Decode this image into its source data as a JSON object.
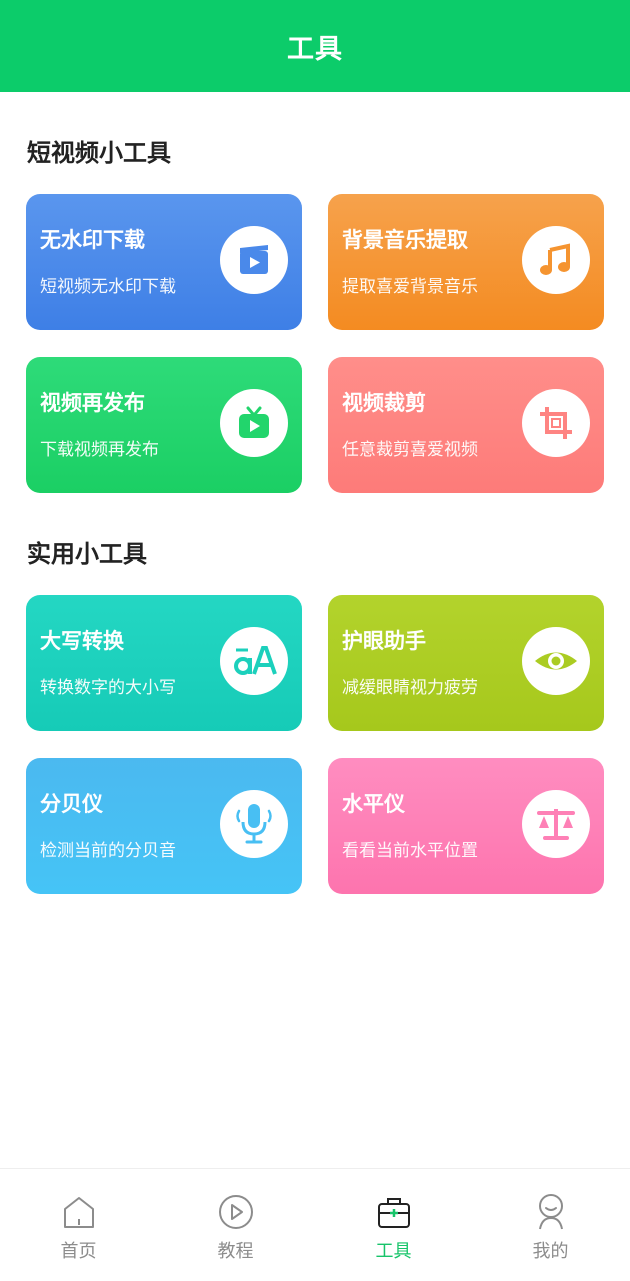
{
  "header": {
    "title": "工具"
  },
  "sections": [
    {
      "title": "短视频小工具",
      "cards": [
        {
          "title": "无水印下载",
          "subtitle": "短视频无水印下载",
          "icon": "video-clapper-icon",
          "color": "#4a89ea"
        },
        {
          "title": "背景音乐提取",
          "subtitle": "提取喜爱背景音乐",
          "icon": "music-note-icon",
          "color": "#f59430"
        },
        {
          "title": "视频再发布",
          "subtitle": "下载视频再发布",
          "icon": "tv-play-icon",
          "color": "#22d56c"
        },
        {
          "title": "视频裁剪",
          "subtitle": "任意裁剪喜爱视频",
          "icon": "crop-icon",
          "color": "#fe8482"
        }
      ]
    },
    {
      "title": "实用小工具",
      "cards": [
        {
          "title": "大写转换",
          "subtitle": "转换数字的大小写",
          "icon": "text-case-icon",
          "color": "#1cd0bc"
        },
        {
          "title": "护眼助手",
          "subtitle": "减缓眼睛视力疲劳",
          "icon": "eye-icon",
          "color": "#abcc22"
        },
        {
          "title": "分贝仪",
          "subtitle": "检测当前的分贝音",
          "icon": "microphone-icon",
          "color": "#48bff3"
        },
        {
          "title": "水平仪",
          "subtitle": "看看当前水平位置",
          "icon": "balance-scale-icon",
          "color": "#fe80b6"
        }
      ]
    }
  ],
  "tabbar": {
    "active": "工具",
    "accent": "#17c46a",
    "items": [
      {
        "label": "首页",
        "icon": "home-icon"
      },
      {
        "label": "教程",
        "icon": "play-circle-icon"
      },
      {
        "label": "工具",
        "icon": "toolbox-icon"
      },
      {
        "label": "我的",
        "icon": "user-icon"
      }
    ]
  }
}
